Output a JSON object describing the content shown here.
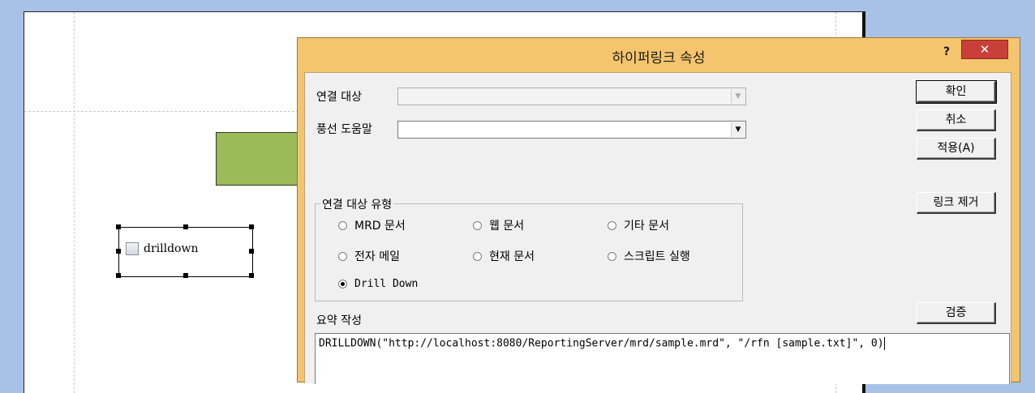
{
  "canvas": {
    "object_label": "drilldown"
  },
  "dialog": {
    "title": "하이퍼링크 속성",
    "help_label": "?",
    "close_label": "✕",
    "link_target_label": "연결 대상",
    "link_target_value": "",
    "tooltip_label": "풍선 도움말",
    "tooltip_value": "",
    "group_title": "연결 대상 유형",
    "radios": [
      {
        "label": "MRD 문서",
        "checked": false
      },
      {
        "label": "웹 문서",
        "checked": false
      },
      {
        "label": "기타 문서",
        "checked": false
      },
      {
        "label": "전자 메일",
        "checked": false
      },
      {
        "label": "현재 문서",
        "checked": false
      },
      {
        "label": "스크립트 실행",
        "checked": false
      },
      {
        "label": "Drill Down",
        "checked": true
      }
    ],
    "summary_label": "요약 작성",
    "summary_text": "DRILLDOWN(\"http://localhost:8080/ReportingServer/mrd/sample.mrd\", \"/rfn [sample.txt]\", 0)",
    "buttons": {
      "ok": "확인",
      "cancel": "취소",
      "apply": "적용(A)",
      "remove_link": "링크 제거",
      "verify": "검증"
    }
  }
}
